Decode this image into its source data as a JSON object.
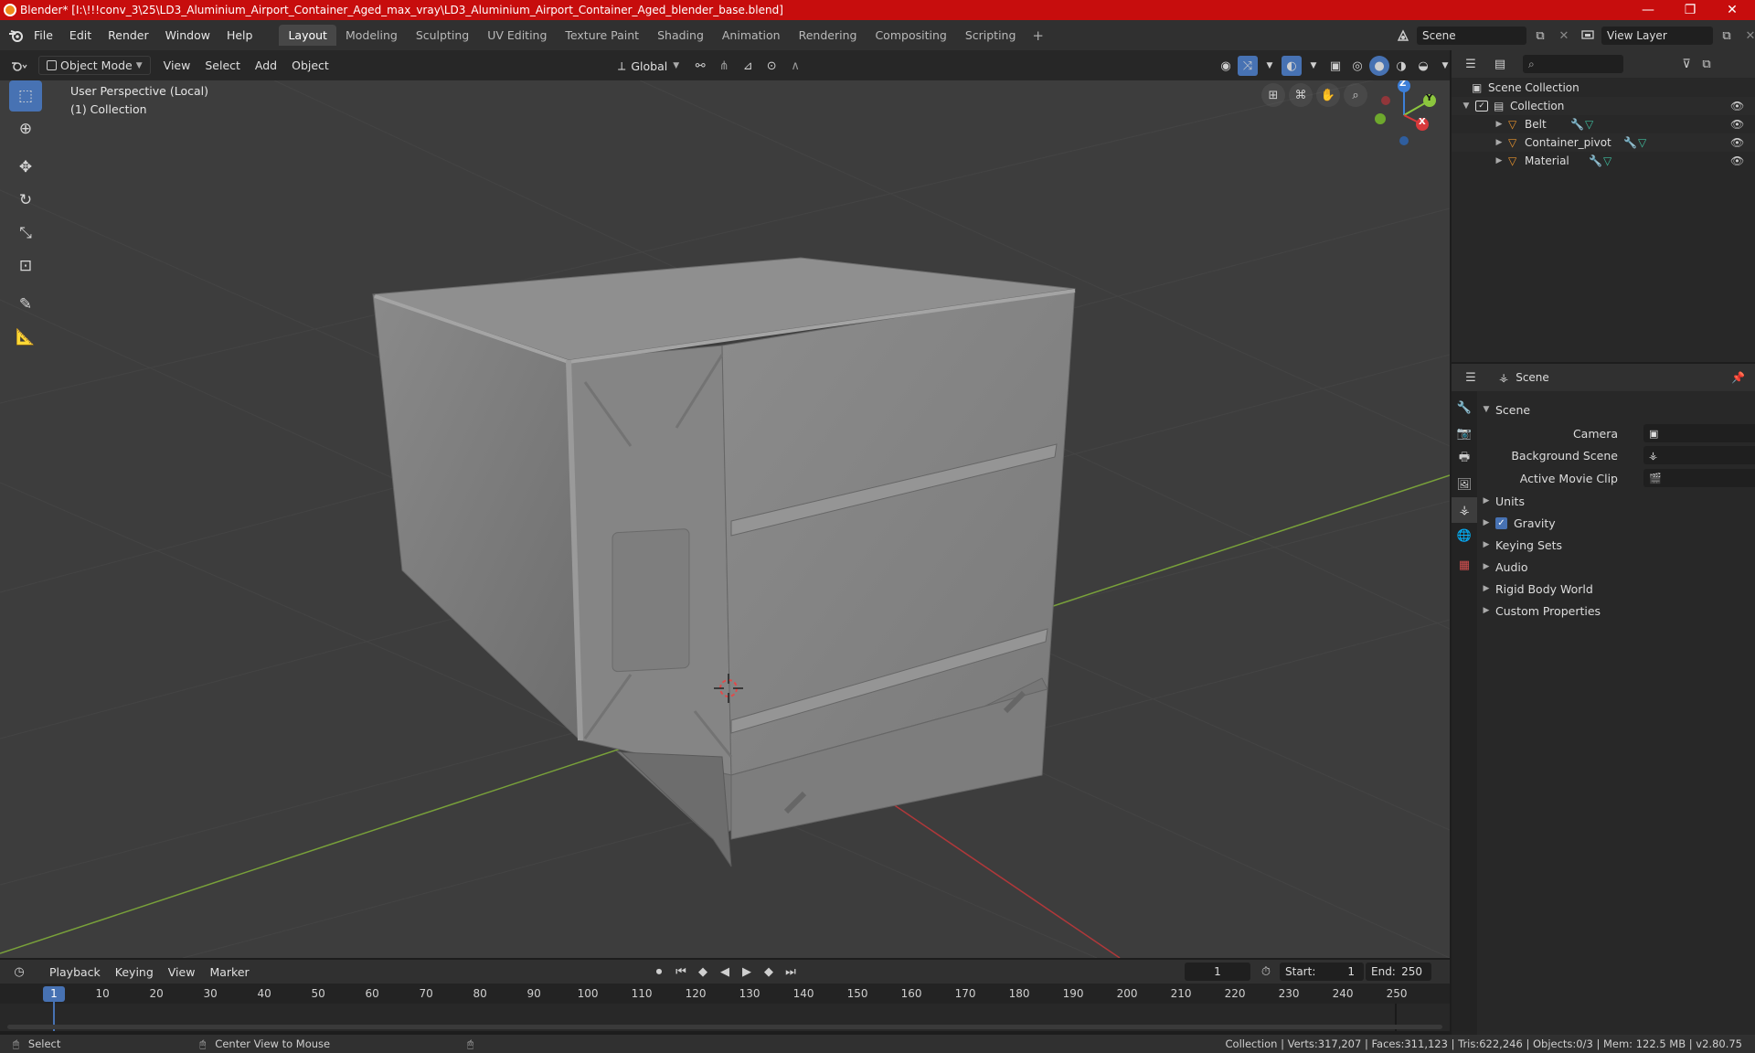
{
  "window": {
    "title": "Blender* [I:\\!!!conv_3\\25\\LD3_Aluminium_Airport_Container_Aged_max_vray\\LD3_Aluminium_Airport_Container_Aged_blender_base.blend]",
    "minimize": "—",
    "maximize": "❐",
    "close": "✕"
  },
  "menubar": {
    "menus": [
      "File",
      "Edit",
      "Render",
      "Window",
      "Help"
    ],
    "workspaces": [
      "Layout",
      "Modeling",
      "Sculpting",
      "UV Editing",
      "Texture Paint",
      "Shading",
      "Animation",
      "Rendering",
      "Compositing",
      "Scripting"
    ],
    "active_workspace": "Layout",
    "add_workspace": "+",
    "scene_name": "Scene",
    "view_layer": "View Layer"
  },
  "viewport_header": {
    "mode": "Object Mode",
    "menus": [
      "View",
      "Select",
      "Add",
      "Object"
    ],
    "orientation": "Global"
  },
  "viewport": {
    "perspective_label": "User Perspective (Local)",
    "collection_label": "(1) Collection",
    "axes": {
      "x": "X",
      "y": "Y",
      "z": "Z"
    }
  },
  "outliner": {
    "search_placeholder": "",
    "root": "Scene Collection",
    "collection": "Collection",
    "objects": [
      "Belt",
      "Container_pivot",
      "Material"
    ]
  },
  "properties": {
    "header_title": "Scene",
    "section": "Scene",
    "fields": [
      {
        "label": "Camera",
        "value": ""
      },
      {
        "label": "Background Scene",
        "value": ""
      },
      {
        "label": "Active Movie Clip",
        "value": ""
      }
    ],
    "panels": [
      "Units",
      "Gravity",
      "Keying Sets",
      "Audio",
      "Rigid Body World",
      "Custom Properties"
    ],
    "gravity_checked": true
  },
  "timeline": {
    "menus": [
      "Playback",
      "Keying",
      "View",
      "Marker"
    ],
    "current_frame": "1",
    "start_label": "Start:",
    "start_value": "1",
    "end_label": "End:",
    "end_value": "250",
    "frame_marker": "1",
    "ticks": [
      "10",
      "20",
      "30",
      "40",
      "50",
      "60",
      "70",
      "80",
      "90",
      "100",
      "110",
      "120",
      "130",
      "140",
      "150",
      "160",
      "170",
      "180",
      "190",
      "200",
      "210",
      "220",
      "230",
      "240",
      "250"
    ]
  },
  "statusbar": {
    "left_action": "Select",
    "middle_action": "Center View to Mouse",
    "stats": "Collection | Verts:317,207 | Faces:311,123 | Tris:622,246 | Objects:0/3 | Mem: 122.5 MB | v2.80.75"
  },
  "colors": {
    "title_bar": "#c70d0d",
    "accent": "#4772b3",
    "x_axis": "#d8393b",
    "y_axis": "#8cc63e",
    "z_axis": "#3d7fd8",
    "object_icon": "#e8932d",
    "modifier_icon": "#6aa8e8",
    "mesh_icon": "#3fbfa0"
  }
}
